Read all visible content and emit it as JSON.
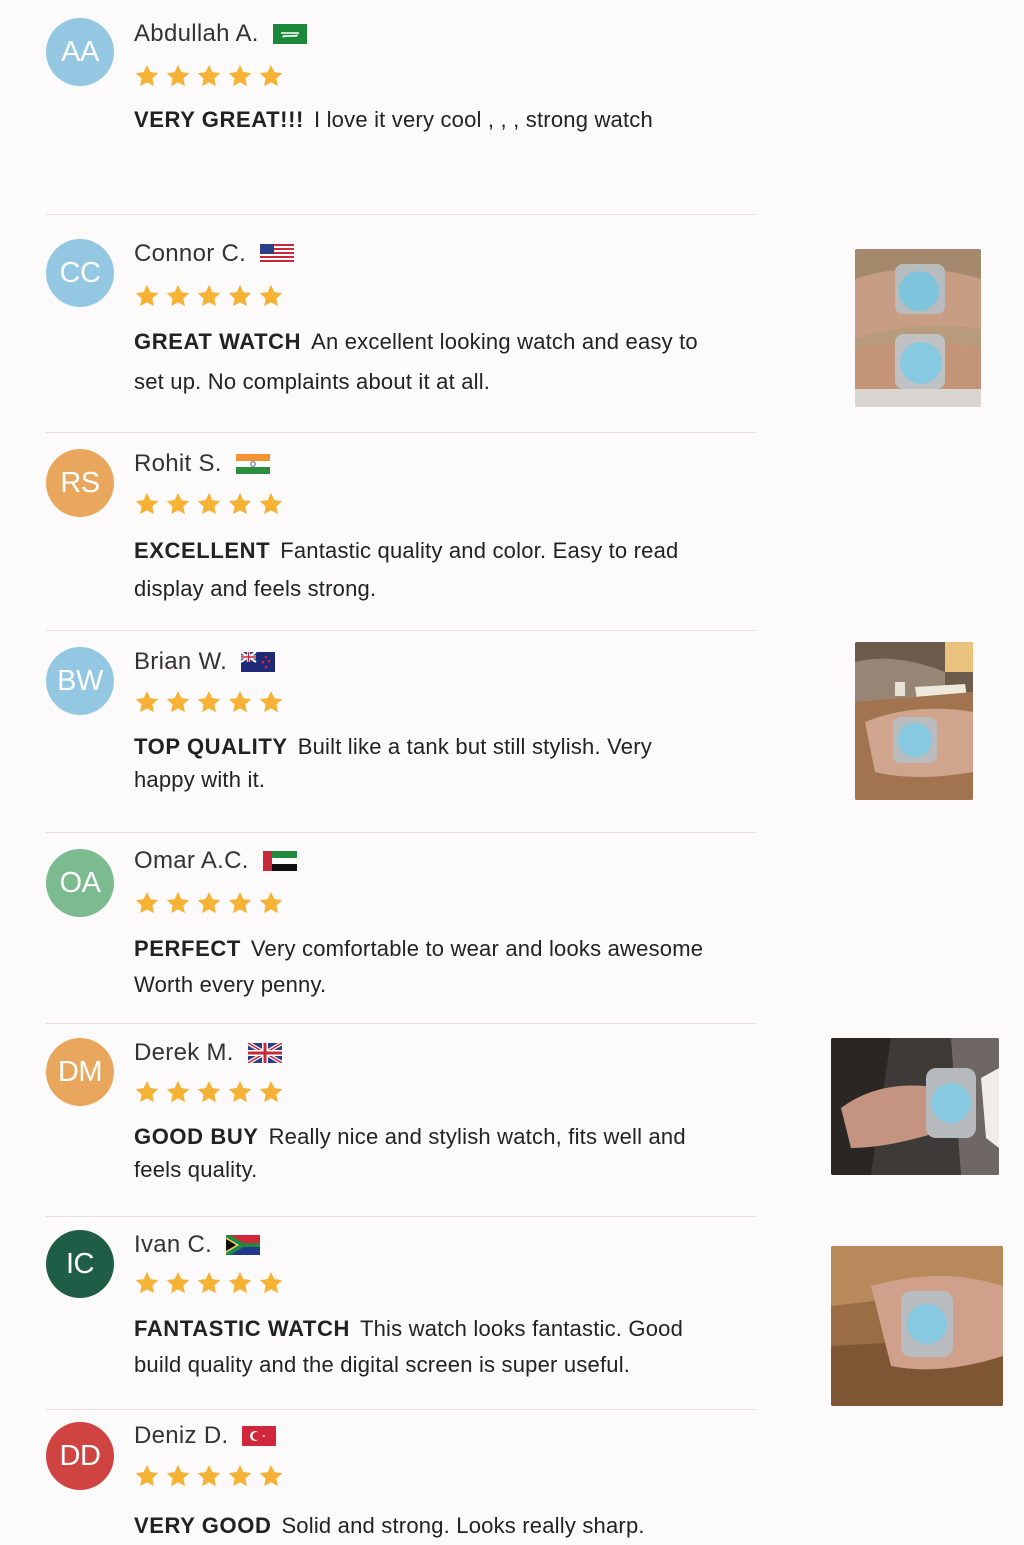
{
  "reviews": [
    {
      "initials": "AA",
      "name": "Abdullah A.",
      "flag": "saudi-arabia-flag-icon",
      "rating": 5,
      "title": "VERY GREAT!!!",
      "body": "I love it very cool , , , strong watch",
      "avatar_color": "#93c7e2"
    },
    {
      "initials": "CC",
      "name": "Connor C.",
      "flag": "usa-flag-icon",
      "rating": 5,
      "title": "GREAT WATCH",
      "body": "An excellent looking watch and easy to",
      "body2": "set up. No complaints about it at all.",
      "avatar_color": "#93c7e2"
    },
    {
      "initials": "RS",
      "name": "Rohit S.",
      "flag": "india-flag-icon",
      "rating": 5,
      "title": "EXCELLENT",
      "body": "Fantastic quality and color. Easy to read",
      "body2": "display and feels strong.",
      "avatar_color": "#e9a75d"
    },
    {
      "initials": "BW",
      "name": "Brian W.",
      "flag": "new-zealand-flag-icon",
      "rating": 5,
      "title": "TOP QUALITY",
      "body": "Built like a tank but still stylish. Very",
      "body2": "happy with it.",
      "avatar_color": "#93c7e2"
    },
    {
      "initials": "OA",
      "name": "Omar A.C.",
      "flag": "uae-flag-icon",
      "rating": 5,
      "title": "PERFECT",
      "body": "Very comfortable to wear and looks awesome",
      "body2": "Worth every penny.",
      "avatar_color": "#7cba8f"
    },
    {
      "initials": "DM",
      "name": "Derek M.",
      "flag": "uk-flag-icon",
      "rating": 5,
      "title": "GOOD BUY",
      "body": "Really nice and  stylish watch, fits well and",
      "body2": "feels quality.",
      "avatar_color": "#e9a75d"
    },
    {
      "initials": "IC",
      "name": "Ivan C.",
      "flag": "south-africa-flag-icon",
      "rating": 5,
      "title": "FANTASTIC WATCH",
      "body": "This watch looks fantastic. Good",
      "body2": "build quality and the digital screen is super useful.",
      "avatar_color": "#1e5e46"
    },
    {
      "initials": "DD",
      "name": "Deniz D.",
      "flag": "turkey-flag-icon",
      "rating": 5,
      "title": "VERY GOOD",
      "body": "Solid and strong. Looks really sharp.",
      "avatar_color": "#cf4341"
    }
  ],
  "photos": [
    {
      "label": "two-wrists-watch-photo"
    },
    {
      "label": "wrist-on-chair-watch-photo"
    },
    {
      "label": "wrist-in-suit-watch-photo"
    },
    {
      "label": "wrist-on-leather-bag-watch-photo"
    }
  ],
  "colors": {
    "star": "#f5b235",
    "background": "#fcfafa",
    "divider": "#e4e0e0"
  }
}
